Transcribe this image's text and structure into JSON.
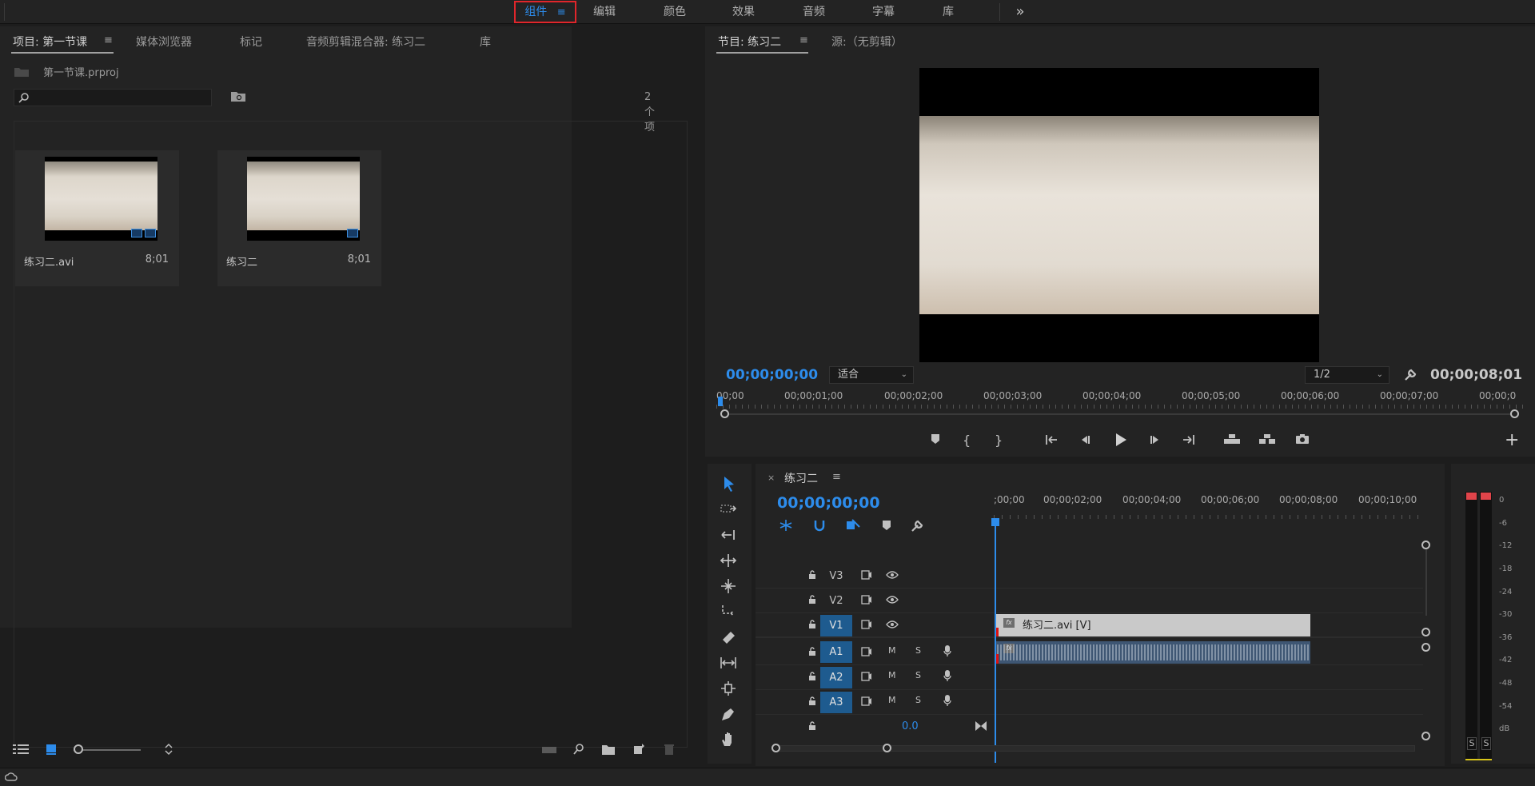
{
  "workspaces": {
    "items": [
      "组件",
      "编辑",
      "颜色",
      "效果",
      "音频",
      "字幕",
      "库"
    ],
    "active_index": 0,
    "overflow_glyph": "»"
  },
  "project_panel": {
    "tabs": [
      "项目: 第一节课",
      "媒体浏览器",
      "标记",
      "音频剪辑混合器: 练习二",
      "库"
    ],
    "active_tab": 0,
    "project_file": "第一节课.prproj",
    "search_placeholder": "",
    "item_count": "2 个项",
    "items": [
      {
        "name": "练习二.avi",
        "duration": "8;01"
      },
      {
        "name": "练习二",
        "duration": "8;01"
      }
    ]
  },
  "program_monitor": {
    "tabs": [
      "节目: 练习二",
      "源:（无剪辑）"
    ],
    "active_tab": 0,
    "timecode_current": "00;00;00;00",
    "timecode_duration": "00;00;08;01",
    "zoom_value": "适合",
    "resolution_value": "1/2",
    "ruler_labels": [
      "00;00",
      "00;00;01;00",
      "00;00;02;00",
      "00;00;03;00",
      "00;00;04;00",
      "00;00;05;00",
      "00;00;06;00",
      "00;00;07;00",
      "00;00;0"
    ]
  },
  "timeline": {
    "sequence_name": "练习二",
    "timecode": "00;00;00;00",
    "ruler_labels": [
      ";00;00",
      "00;00;02;00",
      "00;00;04;00",
      "00;00;06;00",
      "00;00;08;00",
      "00;00;10;00"
    ],
    "tracks": [
      {
        "id": "V3",
        "type": "video",
        "targeted": false
      },
      {
        "id": "V2",
        "type": "video",
        "targeted": false
      },
      {
        "id": "V1",
        "type": "video",
        "targeted": true
      },
      {
        "id": "A1",
        "type": "audio",
        "targeted": true
      },
      {
        "id": "A2",
        "type": "audio",
        "targeted": true
      },
      {
        "id": "A3",
        "type": "audio",
        "targeted": true
      }
    ],
    "master_volume": "0.0",
    "mute_label": "M",
    "solo_label": "S",
    "video_clip_label": "练习二.avi [V]",
    "fx_label": "fx"
  },
  "audio_meter": {
    "scale": [
      "0",
      "-6",
      "-12",
      "-18",
      "-24",
      "-30",
      "-36",
      "-42",
      "-48",
      "-54",
      "dB"
    ],
    "solo_buttons": [
      "S",
      "S"
    ]
  },
  "colors": {
    "accent_blue": "#2d8ceb",
    "active_border": "#e0262b",
    "track_target": "#1e5b8f"
  }
}
